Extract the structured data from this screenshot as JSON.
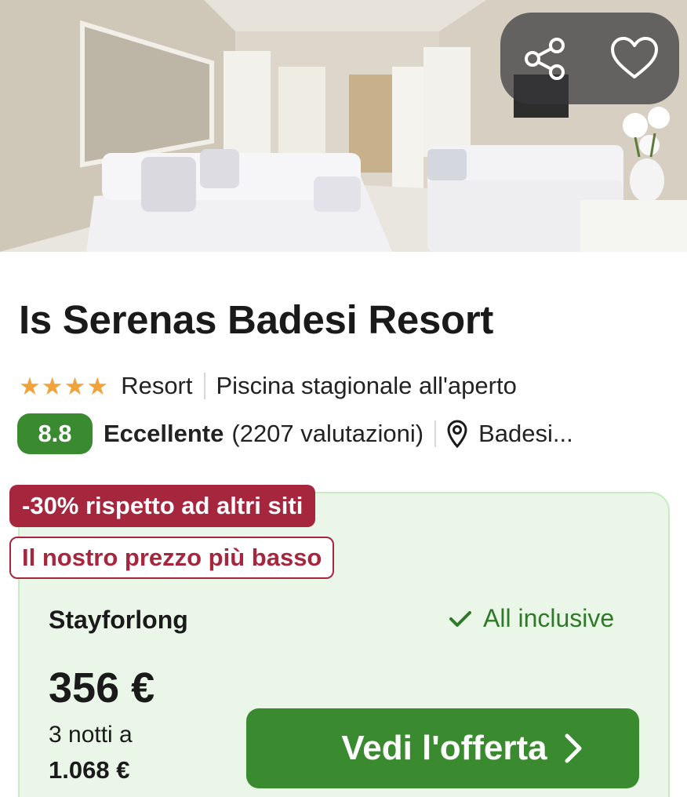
{
  "hero": {
    "share_icon": "share-icon",
    "favorite_icon": "heart-icon"
  },
  "hotel": {
    "name": "Is Serenas Badesi Resort",
    "stars": 4,
    "type": "Resort",
    "amenity": "Piscina stagionale all'aperto",
    "score": "8.8",
    "rating_word": "Eccellente",
    "reviews": "(2207 valutazioni)",
    "location": "Badesi..."
  },
  "offer": {
    "discount_badge": "-30% rispetto ad altri siti",
    "lowest_badge": "Il nostro prezzo più basso",
    "provider": "Stayforlong",
    "inclusive": "All inclusive",
    "price": "356 €",
    "nights": "3 notti a",
    "total": "1.068 €",
    "cta": "Vedi l'offerta"
  },
  "colors": {
    "score_bg": "#3a8a2f",
    "discount_bg": "#a6263e",
    "card_bg": "#eaf7e8",
    "star": "#f2a23a"
  }
}
